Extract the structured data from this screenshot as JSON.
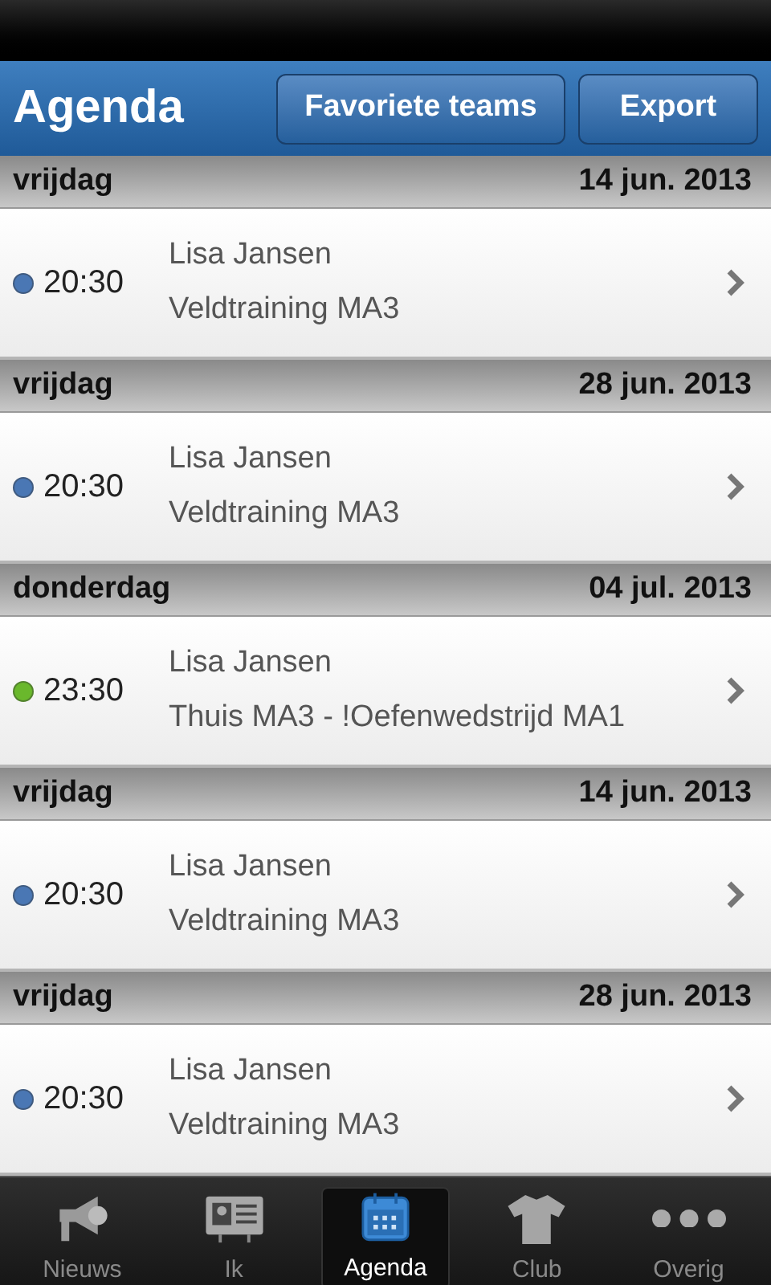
{
  "header": {
    "title": "Agenda",
    "buttons": [
      "Favoriete teams",
      "Export"
    ]
  },
  "days": [
    {
      "weekday": "vrijdag",
      "date": "14 jun. 2013",
      "events": [
        {
          "time": "20:30",
          "person": "Lisa Jansen",
          "title": "Veldtraining MA3",
          "color": "#4a77b4"
        }
      ]
    },
    {
      "weekday": "vrijdag",
      "date": "28 jun. 2013",
      "events": [
        {
          "time": "20:30",
          "person": "Lisa Jansen",
          "title": "Veldtraining MA3",
          "color": "#4a77b4"
        }
      ]
    },
    {
      "weekday": "donderdag",
      "date": "04 jul. 2013",
      "events": [
        {
          "time": "23:30",
          "person": "Lisa Jansen",
          "title": "Thuis MA3 - !Oefenwedstrijd MA1",
          "color": "#6ab82c"
        }
      ]
    },
    {
      "weekday": "vrijdag",
      "date": "14 jun. 2013",
      "events": [
        {
          "time": "20:30",
          "person": "Lisa Jansen",
          "title": "Veldtraining MA3",
          "color": "#4a77b4"
        }
      ]
    },
    {
      "weekday": "vrijdag",
      "date": "28 jun. 2013",
      "events": [
        {
          "time": "20:30",
          "person": "Lisa Jansen",
          "title": "Veldtraining MA3",
          "color": "#4a77b4"
        }
      ]
    }
  ],
  "tabs": [
    {
      "kind": "news",
      "label": "Nieuws",
      "selected": false
    },
    {
      "kind": "me",
      "label": "Ik",
      "selected": false
    },
    {
      "kind": "calendar",
      "label": "Agenda",
      "selected": true
    },
    {
      "kind": "club",
      "label": "Club",
      "selected": false
    },
    {
      "kind": "more",
      "label": "Overig",
      "selected": false
    }
  ]
}
